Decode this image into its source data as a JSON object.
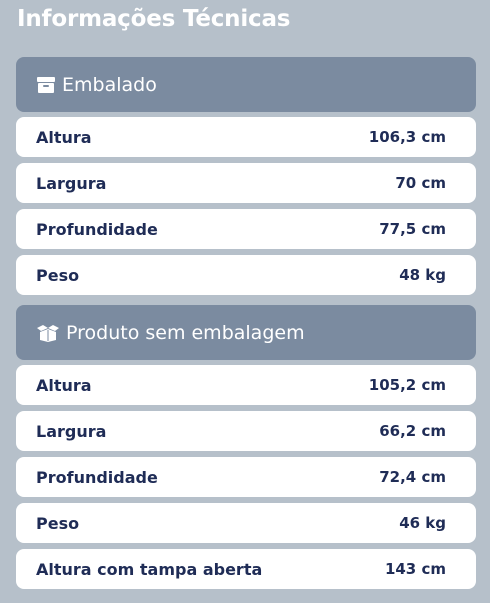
{
  "title": "Informações Técnicas",
  "sections": [
    {
      "icon": "box-icon",
      "header": "Embalado",
      "rows": [
        {
          "label": "Altura",
          "value": "106,3 cm"
        },
        {
          "label": "Largura",
          "value": "70 cm"
        },
        {
          "label": "Profundidade",
          "value": "77,5 cm"
        },
        {
          "label": "Peso",
          "value": "48 kg"
        }
      ]
    },
    {
      "icon": "open-box-icon",
      "header": "Produto sem embalagem",
      "rows": [
        {
          "label": "Altura",
          "value": "105,2 cm"
        },
        {
          "label": "Largura",
          "value": "66,2 cm"
        },
        {
          "label": "Profundidade",
          "value": "72,4 cm"
        },
        {
          "label": "Peso",
          "value": "46 kg"
        },
        {
          "label": "Altura com tampa aberta",
          "value": "143 cm"
        }
      ]
    }
  ],
  "colors": {
    "background": "#b6c0ca",
    "header": "#7b8ba0",
    "row": "#ffffff",
    "text": "#1f2c56"
  }
}
